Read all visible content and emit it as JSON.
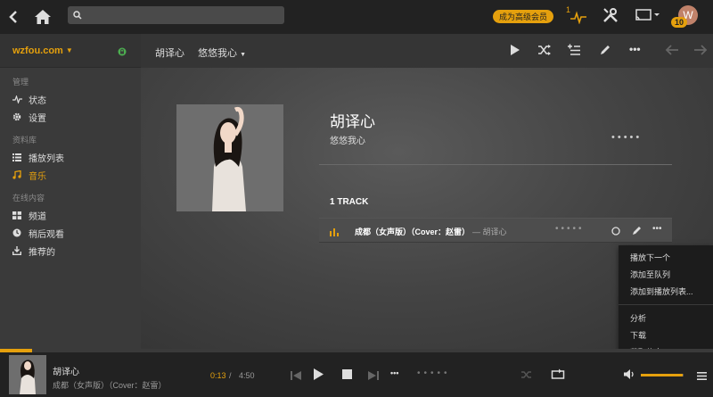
{
  "topbar": {
    "search_placeholder": "",
    "upgrade_label": "成为高级会员",
    "activity_count": "1",
    "avatar_letter": "W",
    "avatar_badge": "10"
  },
  "sidebar": {
    "server_name": "wzfou.com",
    "sections": [
      {
        "title": "管理",
        "items": [
          {
            "label": "状态",
            "icon": "pulse-icon"
          },
          {
            "label": "设置",
            "icon": "gear-icon"
          }
        ]
      },
      {
        "title": "资料库",
        "items": [
          {
            "label": "播放列表",
            "icon": "list-icon"
          },
          {
            "label": "音乐",
            "icon": "music-note-icon",
            "active": true
          }
        ]
      },
      {
        "title": "在线内容",
        "items": [
          {
            "label": "频道",
            "icon": "grid-icon"
          },
          {
            "label": "稍后观看",
            "icon": "clock-icon"
          },
          {
            "label": "推荐的",
            "icon": "download-icon"
          }
        ]
      }
    ]
  },
  "header": {
    "crumb_artist": "胡译心",
    "crumb_album": "悠悠我心"
  },
  "album": {
    "artist": "胡译心",
    "title": "悠悠我心",
    "track_count_label": "1 TRACK"
  },
  "track": {
    "name": "成都（女声版）（Cover：赵雷）",
    "artist": "— 胡译心"
  },
  "context_menu": {
    "group1": [
      "播放下一个",
      "添加至队列",
      "添加到播放列表..."
    ],
    "group2": [
      "分析",
      "下载",
      "获取信息"
    ]
  },
  "player": {
    "artist": "胡译心",
    "track": "成都（女声版）（Cover：赵雷）",
    "time_current": "0:13",
    "time_separator": "/",
    "time_total": "4:50",
    "progress": 0.045,
    "volume": 0.98
  },
  "colors": {
    "accent": "#e5a00d",
    "topbar": "#222222",
    "sidebar": "#3a3a3a"
  }
}
